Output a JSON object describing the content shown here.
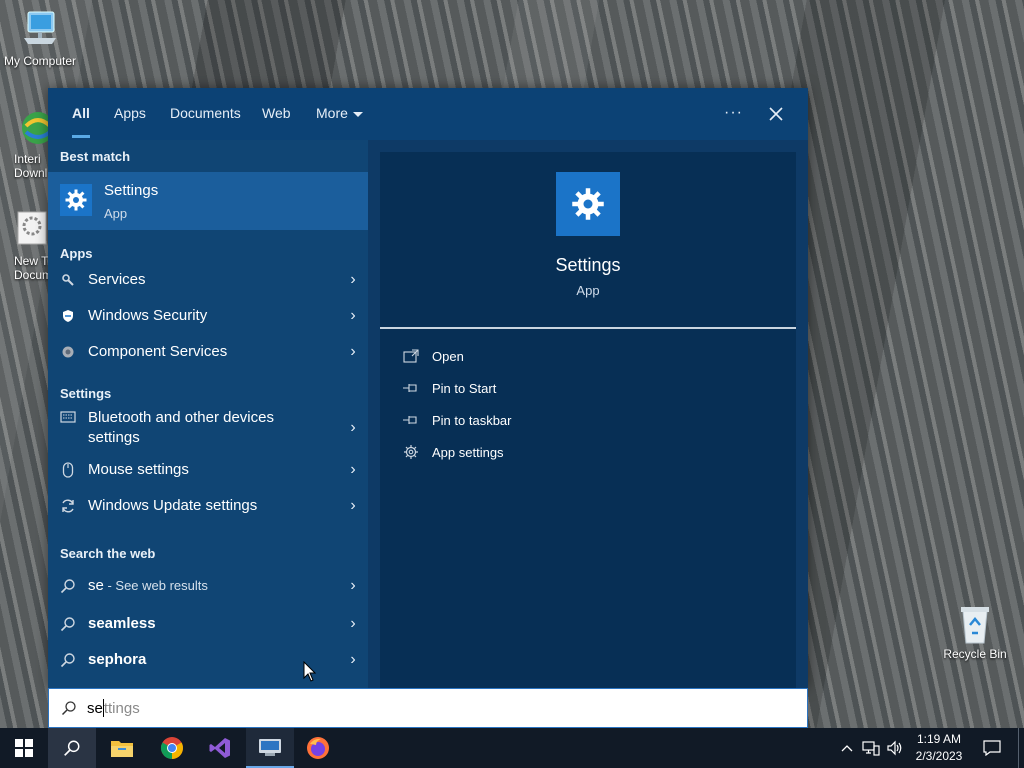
{
  "desktop": {
    "icons": [
      {
        "label": "My Computer"
      },
      {
        "label": "Interi\nDownl"
      },
      {
        "label": "New T\nDocum"
      },
      {
        "label": "Recycle Bin"
      }
    ]
  },
  "search_panel": {
    "tabs": [
      "All",
      "Apps",
      "Documents",
      "Web",
      "More"
    ],
    "options_label": "···",
    "best_match": {
      "section": "Best match",
      "title": "Settings",
      "subtitle": "App"
    },
    "apps": {
      "section": "Apps",
      "items": [
        "Services",
        "Windows Security",
        "Component Services"
      ]
    },
    "settings": {
      "section": "Settings",
      "items": [
        "Bluetooth and other devices settings",
        "Mouse settings",
        "Windows Update settings"
      ]
    },
    "web": {
      "section": "Search the web",
      "items": [
        {
          "main": "se",
          "suffix": " - See web results"
        },
        {
          "main": "seamless",
          "suffix": ""
        },
        {
          "main": "sephora",
          "suffix": ""
        }
      ]
    },
    "preview": {
      "title": "Settings",
      "subtitle": "App",
      "actions": [
        "Open",
        "Pin to Start",
        "Pin to taskbar",
        "App settings"
      ]
    }
  },
  "search_box": {
    "typed": "se",
    "suggestion": "ttings"
  },
  "taskbar": {
    "time": "1:19 AM",
    "date": "2/3/2023"
  },
  "colors": {
    "panel": "#0e3a66",
    "accent": "#1b74c8",
    "selected_row": "#1b5e9c"
  }
}
